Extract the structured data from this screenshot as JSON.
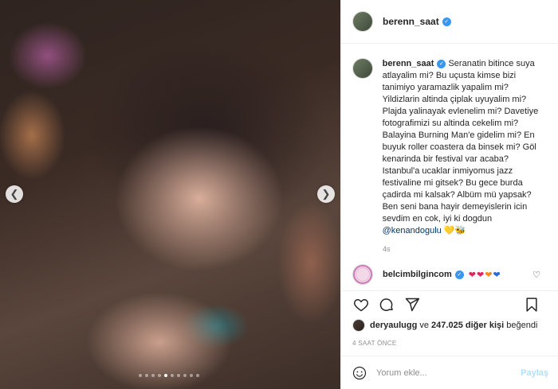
{
  "post": {
    "carousel": {
      "slide_count": 10,
      "active_slide": 5
    }
  },
  "header": {
    "username": "berenn_saat"
  },
  "caption": {
    "username": "berenn_saat",
    "text": "Seranatin bitince suya atlayalim mi? Bu uçusta kimse bizi tanimiyo yaramazlik yapalim mi? Yildizlarin altinda çiplak uyuyalim mi? Plajda yalinayak evlenelim mi? Davetiye fotografimizi su altinda cekelim mi? Balayina Burning Man'e gidelim mi? En buyuk roller coastera da binsek mi? Göl kenarinda bir festival var acaba? Istanbul'a ucaklar inmiyomus jazz festivaline mi gitsek? Bu gece burda çadirda mi kalsak? Albüm mü yapsak? Ben seni bana hayir demeyislerin icin sevdim en cok, iyi ki dogdun",
    "mention": "@kenandogulu",
    "emoji": "💛🐝",
    "time": "4s"
  },
  "comment": {
    "username": "belcimbilgincom",
    "hearts": [
      "❤",
      "❤",
      "❤",
      "❤"
    ]
  },
  "likes": {
    "user": "deryaulugg",
    "connector": "ve",
    "count": "247.025",
    "suffix": "diğer kişi",
    "verb": "beğendi"
  },
  "timestamp": "4 SAAT ÖNCE",
  "comment_box": {
    "placeholder": "Yorum ekle...",
    "post_label": "Paylaş"
  },
  "icons": {
    "like": "heart-icon",
    "comment": "comment-icon",
    "share": "share-icon",
    "save": "bookmark-icon",
    "emoji": "emoji-icon"
  },
  "colors": {
    "verified": "#3897f0",
    "mention": "#00376b",
    "post_disabled": "#b2dffc"
  }
}
